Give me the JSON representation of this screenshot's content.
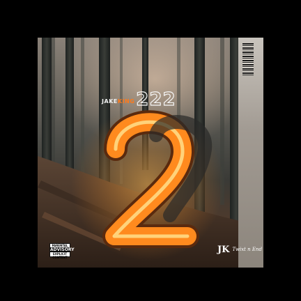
{
  "cover": {
    "artist_first": "JAKE",
    "artist_last": "KING",
    "album_title": "222",
    "parental_advisory": {
      "top": "PARENTAL",
      "middle": "ADVISORY",
      "bottom": "EXPLICIT CONTENT"
    },
    "label_monogram": "JK",
    "label_name": "Twixt n End"
  },
  "colors": {
    "background": "#000000",
    "neon_orange": "#ff8a1e",
    "neon_glow": "#ffb24a",
    "forest_dark": "#2b2e2b",
    "ground_brown": "#4e3a2c"
  },
  "icons": [
    "barcode-icon",
    "parental-advisory-icon",
    "neon-number-two"
  ]
}
